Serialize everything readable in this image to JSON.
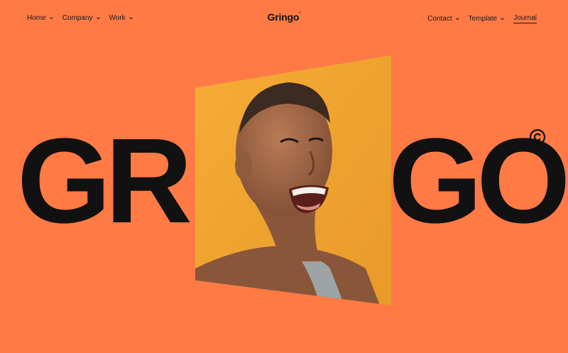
{
  "nav": {
    "left": [
      {
        "label": "Home"
      },
      {
        "label": "Company"
      },
      {
        "label": "Work"
      }
    ],
    "right": [
      {
        "label": "Contact"
      },
      {
        "label": "Template"
      },
      {
        "label": "Journal"
      }
    ]
  },
  "brand": {
    "logo": "Gringo",
    "logo_mark": "°",
    "hero_left": "GR",
    "hero_right": "GO",
    "copyright_symbol": "©"
  },
  "colors": {
    "background": "#ff7a45",
    "text": "#111111",
    "photo_backdrop": "#f2a531"
  },
  "image": {
    "subject": "woman-laughing-portrait"
  }
}
